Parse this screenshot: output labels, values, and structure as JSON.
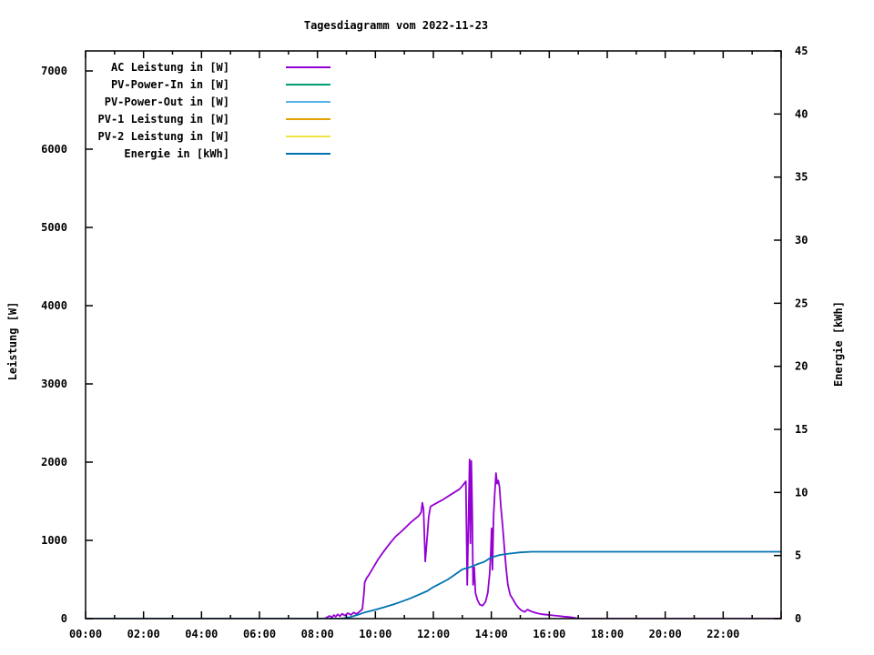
{
  "title": "Tagesdiagramm vom 2022-11-23",
  "chart_data": {
    "type": "line",
    "title": "Tagesdiagramm vom 2022-11-23",
    "grid": false,
    "legend_position": "top-left-inside",
    "x_axis": {
      "unit": "time",
      "range_hours": [
        0,
        24
      ],
      "major_tick_hours": 2,
      "minor_tick_hours": 1,
      "tick_labels": [
        "00:00",
        "02:00",
        "04:00",
        "06:00",
        "08:00",
        "10:00",
        "12:00",
        "14:00",
        "16:00",
        "18:00",
        "20:00",
        "22:00"
      ]
    },
    "left_axis": {
      "label": "Leistung [W]",
      "range": [
        0,
        7000
      ],
      "tick_step": 1000,
      "tick_labels": [
        "0",
        "1000",
        "2000",
        "3000",
        "4000",
        "5000",
        "6000",
        "7000"
      ]
    },
    "right_axis": {
      "label": "Energie [kWh]",
      "range": [
        0,
        45
      ],
      "tick_step": 5,
      "tick_labels": [
        "0",
        "5",
        "10",
        "15",
        "20",
        "25",
        "30",
        "35",
        "40",
        "45"
      ]
    },
    "series": [
      {
        "name": "AC Leistung in [W]",
        "color": "#9400D3",
        "axis": "left",
        "points": [
          [
            0,
            0
          ],
          [
            8.25,
            0
          ],
          [
            8.42,
            35
          ],
          [
            8.5,
            15
          ],
          [
            8.57,
            45
          ],
          [
            8.63,
            25
          ],
          [
            8.7,
            55
          ],
          [
            8.78,
            30
          ],
          [
            8.85,
            62
          ],
          [
            8.95,
            40
          ],
          [
            9.05,
            70
          ],
          [
            9.15,
            48
          ],
          [
            9.25,
            78
          ],
          [
            9.35,
            58
          ],
          [
            9.45,
            88
          ],
          [
            9.55,
            120
          ],
          [
            9.6,
            300
          ],
          [
            9.63,
            465
          ],
          [
            9.7,
            520
          ],
          [
            9.78,
            560
          ],
          [
            9.94,
            660
          ],
          [
            10.1,
            760
          ],
          [
            10.25,
            840
          ],
          [
            10.4,
            915
          ],
          [
            10.56,
            990
          ],
          [
            10.7,
            1050
          ],
          [
            10.87,
            1105
          ],
          [
            11.03,
            1160
          ],
          [
            11.19,
            1220
          ],
          [
            11.35,
            1270
          ],
          [
            11.5,
            1315
          ],
          [
            11.58,
            1360
          ],
          [
            11.62,
            1480
          ],
          [
            11.66,
            1400
          ],
          [
            11.72,
            730
          ],
          [
            11.78,
            1010
          ],
          [
            11.84,
            1300
          ],
          [
            11.9,
            1430
          ],
          [
            12.0,
            1455
          ],
          [
            12.15,
            1485
          ],
          [
            12.3,
            1515
          ],
          [
            12.45,
            1550
          ],
          [
            12.6,
            1585
          ],
          [
            12.75,
            1620
          ],
          [
            12.9,
            1655
          ],
          [
            13.0,
            1695
          ],
          [
            13.08,
            1735
          ],
          [
            13.12,
            1755
          ],
          [
            13.15,
            950
          ],
          [
            13.17,
            430
          ],
          [
            13.21,
            1210
          ],
          [
            13.25,
            2035
          ],
          [
            13.28,
            960
          ],
          [
            13.31,
            2015
          ],
          [
            13.34,
            1400
          ],
          [
            13.37,
            430
          ],
          [
            13.41,
            655
          ],
          [
            13.45,
            330
          ],
          [
            13.52,
            240
          ],
          [
            13.6,
            180
          ],
          [
            13.7,
            165
          ],
          [
            13.8,
            215
          ],
          [
            13.88,
            330
          ],
          [
            13.94,
            570
          ],
          [
            13.98,
            820
          ],
          [
            14.01,
            1155
          ],
          [
            14.04,
            625
          ],
          [
            14.08,
            1330
          ],
          [
            14.12,
            1610
          ],
          [
            14.16,
            1860
          ],
          [
            14.2,
            1725
          ],
          [
            14.24,
            1765
          ],
          [
            14.28,
            1685
          ],
          [
            14.33,
            1425
          ],
          [
            14.39,
            1185
          ],
          [
            14.45,
            905
          ],
          [
            14.51,
            645
          ],
          [
            14.57,
            435
          ],
          [
            14.65,
            305
          ],
          [
            14.75,
            245
          ],
          [
            14.85,
            180
          ],
          [
            14.95,
            132
          ],
          [
            15.05,
            102
          ],
          [
            15.15,
            86
          ],
          [
            15.25,
            115
          ],
          [
            15.35,
            96
          ],
          [
            15.45,
            82
          ],
          [
            15.6,
            66
          ],
          [
            15.75,
            56
          ],
          [
            15.9,
            50
          ],
          [
            16.1,
            42
          ],
          [
            16.3,
            35
          ],
          [
            16.5,
            26
          ],
          [
            16.7,
            20
          ],
          [
            16.85,
            12
          ],
          [
            16.95,
            5
          ],
          [
            17.05,
            0
          ],
          [
            24,
            0
          ]
        ]
      },
      {
        "name": "PV-Power-In in [W]",
        "color": "#009E73",
        "axis": "left",
        "points": []
      },
      {
        "name": "PV-Power-Out in [W]",
        "color": "#56B4E9",
        "axis": "left",
        "points": []
      },
      {
        "name": "PV-1 Leistung in [W]",
        "color": "#E69F00",
        "axis": "left",
        "points": []
      },
      {
        "name": "PV-2 Leistung in [W]",
        "color": "#F0E442",
        "axis": "left",
        "points": []
      },
      {
        "name": "Energie in [kWh]",
        "color": "#0072B2",
        "axis": "right",
        "points": [
          [
            0,
            0
          ],
          [
            8.8,
            0
          ],
          [
            9.1,
            0.1
          ],
          [
            9.4,
            0.3
          ],
          [
            9.62,
            0.48
          ],
          [
            10.0,
            0.7
          ],
          [
            10.3,
            0.9
          ],
          [
            10.65,
            1.15
          ],
          [
            10.9,
            1.35
          ],
          [
            11.2,
            1.6
          ],
          [
            11.5,
            1.9
          ],
          [
            11.8,
            2.2
          ],
          [
            12.0,
            2.5
          ],
          [
            12.25,
            2.8
          ],
          [
            12.5,
            3.1
          ],
          [
            12.75,
            3.5
          ],
          [
            13.0,
            3.9
          ],
          [
            13.3,
            4.1
          ],
          [
            13.5,
            4.3
          ],
          [
            13.75,
            4.5
          ],
          [
            14.0,
            4.85
          ],
          [
            14.3,
            5.05
          ],
          [
            14.6,
            5.15
          ],
          [
            15.0,
            5.25
          ],
          [
            15.4,
            5.3
          ],
          [
            24,
            5.3
          ]
        ]
      }
    ]
  }
}
